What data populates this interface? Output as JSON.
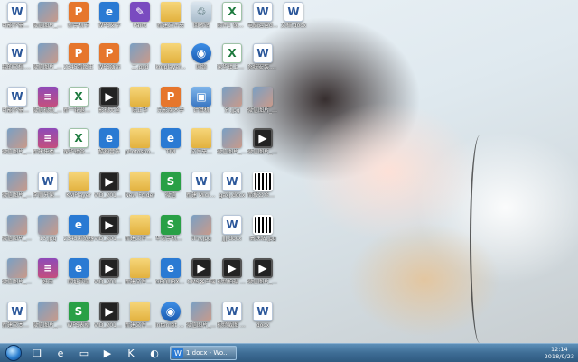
{
  "desktop": {
    "icons": [
      {
        "label": "可能不需要...",
        "icon": "word"
      },
      {
        "label": "微信图片_20180911...",
        "icon": "image"
      },
      {
        "label": "新手机卡",
        "icon": "app-orange"
      },
      {
        "label": "WPS文字",
        "icon": "app-blue"
      },
      {
        "label": "Paint",
        "icon": "app-purple"
      },
      {
        "label": "新建文件夹",
        "icon": "folder"
      },
      {
        "label": "回收站",
        "icon": "trash"
      },
      {
        "label": "附件1 保全期2018年...",
        "icon": "excel"
      },
      {
        "label": "电脑运营docx",
        "icon": "word"
      },
      {
        "label": "文档.docx",
        "icon": "word"
      },
      {
        "label": "我的文档.docx",
        "icon": "word"
      },
      {
        "label": "微信图片_20180911...",
        "icon": "image"
      },
      {
        "label": "2345看图王",
        "icon": "app-orange"
      },
      {
        "label": "WPS演示",
        "icon": "app-orange"
      },
      {
        "label": "二.psd",
        "icon": "image"
      },
      {
        "label": "kmplayer...",
        "icon": "folder"
      },
      {
        "label": "网络",
        "icon": "net"
      },
      {
        "label": "保华镇上报新一轮...",
        "icon": "excel"
      },
      {
        "label": "系统安装.docx",
        "icon": "word"
      },
      {
        "label": "可能不需要...",
        "icon": "word"
      },
      {
        "label": "微信视频_20180...",
        "icon": "app-rar"
      },
      {
        "label": "新一轮退耕还林数据...",
        "icon": "excel"
      },
      {
        "label": "影视大全",
        "icon": "video"
      },
      {
        "label": "陈正华",
        "icon": "folder"
      },
      {
        "label": "光影魔术手",
        "icon": "app-orange"
      },
      {
        "label": "计算机",
        "icon": "pc"
      },
      {
        "label": "分.jpg",
        "icon": "image"
      },
      {
        "label": "微信图片_20180...",
        "icon": "image"
      },
      {
        "label": "微信图片_20180...",
        "icon": "image"
      },
      {
        "label": "新建快播技术.rar",
        "icon": "app-rar"
      },
      {
        "label": "保华镇各报富农申请...",
        "icon": "excel"
      },
      {
        "label": "酷狗音乐",
        "icon": "app-blue"
      },
      {
        "label": "photosho...",
        "icon": "folder"
      },
      {
        "label": "TIM",
        "icon": "app-blue"
      },
      {
        "label": "文件夹...",
        "icon": "folder"
      },
      {
        "label": "微信图片_2018...",
        "icon": "image"
      },
      {
        "label": "微信图片_2018...",
        "icon": "video"
      },
      {
        "label": "微信图片_20180...",
        "icon": "image"
      },
      {
        "label": "李丽分保管理档案.doc",
        "icon": "word"
      },
      {
        "label": "KMPlayer",
        "icon": "folder"
      },
      {
        "label": "VID_2018...",
        "icon": "video"
      },
      {
        "label": "New Folder",
        "icon": "folder"
      },
      {
        "label": "微信",
        "icon": "app-green"
      },
      {
        "label": "新建 Microsoft...",
        "icon": "word"
      },
      {
        "label": "gaxj.docx",
        "icon": "word"
      },
      {
        "label": "简报公众号宣传手册...",
        "icon": "qr"
      },
      {
        "label": "微信图片_20180...",
        "icon": "image"
      },
      {
        "label": "13.jpg",
        "icon": "image"
      },
      {
        "label": "2345浏览器",
        "icon": "app-blue"
      },
      {
        "label": "VID_2018...",
        "icon": "video"
      },
      {
        "label": "新建文件夹(2)",
        "icon": "folder"
      },
      {
        "label": "华为手机助手",
        "icon": "app-green"
      },
      {
        "label": "tiny.jpg",
        "icon": "image"
      },
      {
        "label": "jjj.docx",
        "icon": "word"
      },
      {
        "label": "高铁站.jpg",
        "icon": "qr"
      },
      {
        "label": "微信图片_20180911...",
        "icon": "image"
      },
      {
        "label": "好压",
        "icon": "app-rar"
      },
      {
        "label": "网址导航",
        "icon": "app-blue"
      },
      {
        "label": "VID_2018...",
        "icon": "video"
      },
      {
        "label": "新建文件夹(3)",
        "icon": "folder"
      },
      {
        "label": "GEOLIBX-Builder",
        "icon": "app-blue"
      },
      {
        "label": "CMS客户端",
        "icon": "video"
      },
      {
        "label": "视频拍摄 3 4...",
        "icon": "video"
      },
      {
        "label": "微信图片_20180...",
        "icon": "video"
      },
      {
        "label": "新建文本文档.docx",
        "icon": "word"
      },
      {
        "label": "微信图片_20180...",
        "icon": "image"
      },
      {
        "label": "WPS表格",
        "icon": "app-green"
      },
      {
        "label": "VID_2018...",
        "icon": "video"
      },
      {
        "label": "新建文件夹(4)",
        "icon": "folder"
      },
      {
        "label": "Internet Explorer",
        "icon": "net"
      },
      {
        "label": "微信图片_20180...",
        "icon": "image"
      },
      {
        "label": "视频截图 下手...",
        "icon": "word"
      },
      {
        "label": "docx",
        "icon": "word"
      }
    ]
  },
  "taskbar": {
    "pinned": [
      {
        "name": "explorer-icon",
        "glyph": "❏"
      },
      {
        "name": "ie-icon",
        "glyph": "e"
      },
      {
        "name": "folder-icon",
        "glyph": "▭"
      },
      {
        "name": "media-icon",
        "glyph": "▶"
      },
      {
        "name": "kugou-icon",
        "glyph": "K"
      },
      {
        "name": "browser-icon",
        "glyph": "◐"
      }
    ],
    "task": {
      "label": "1.docx - Wo..."
    },
    "clock": {
      "time": "12:14",
      "date": "2018/9/23"
    }
  },
  "colors": {
    "taskbar_top": "#5d8fb8",
    "taskbar_bottom": "#2f5a80",
    "label_text": "#ffffff"
  }
}
